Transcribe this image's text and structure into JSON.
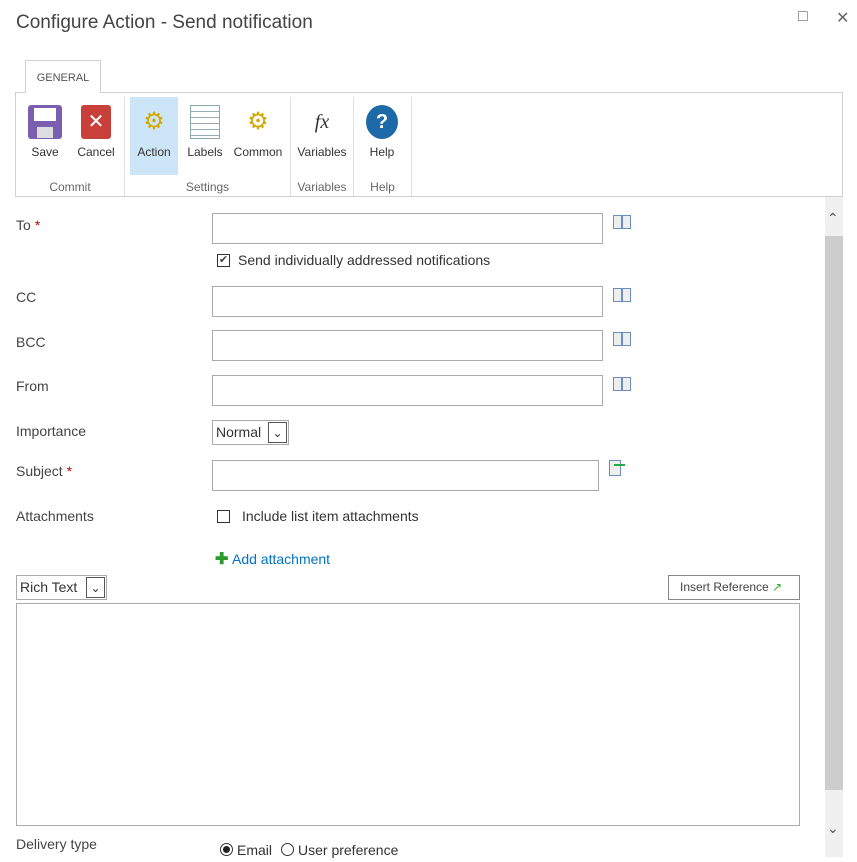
{
  "window": {
    "title": "Configure Action - Send notification"
  },
  "ribbon": {
    "tab": "GENERAL",
    "buttons": {
      "save": "Save",
      "cancel": "Cancel",
      "action": "Action",
      "labels": "Labels",
      "common": "Common",
      "variables": "Variables",
      "help": "Help"
    },
    "groups": {
      "commit": "Commit",
      "settings": "Settings",
      "variables": "Variables",
      "help": "Help"
    }
  },
  "form": {
    "to": {
      "label": "To",
      "required": "*",
      "value": ""
    },
    "send_individually": {
      "label": "Send individually addressed notifications",
      "checked": true
    },
    "cc": {
      "label": "CC",
      "value": ""
    },
    "bcc": {
      "label": "BCC",
      "value": ""
    },
    "from": {
      "label": "From",
      "value": ""
    },
    "importance": {
      "label": "Importance",
      "value": "Normal"
    },
    "subject": {
      "label": "Subject",
      "required": "*",
      "value": ""
    },
    "attachments": {
      "label": "Attachments",
      "include_label": "Include list item attachments",
      "checked": false,
      "add_label": "Add attachment"
    },
    "body_format": "Rich Text",
    "insert_reference": "Insert Reference",
    "delivery": {
      "label": "Delivery type",
      "options": [
        "Email",
        "User preference"
      ],
      "selected": "Email"
    }
  }
}
